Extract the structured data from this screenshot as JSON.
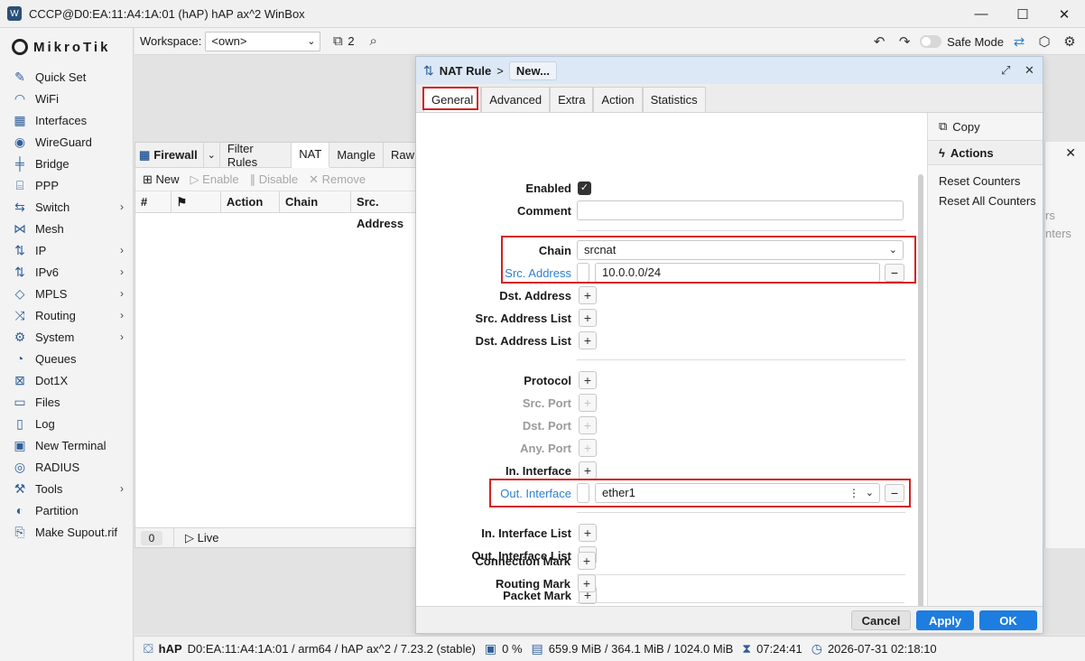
{
  "window": {
    "title": "CCCP@D0:EA:11:A4:1A:01 (hAP) hAP ax^2 WinBox",
    "controls": [
      "—",
      "☐",
      "✕"
    ]
  },
  "sidebar": {
    "logo": "MikroTik",
    "items": [
      {
        "label": "Quick Set",
        "icon": "wand-icon",
        "arrow": false
      },
      {
        "label": "WiFi",
        "icon": "wifi-icon",
        "arrow": false
      },
      {
        "label": "Interfaces",
        "icon": "interfaces-icon",
        "arrow": false
      },
      {
        "label": "WireGuard",
        "icon": "wireguard-icon",
        "arrow": false
      },
      {
        "label": "Bridge",
        "icon": "bridge-icon",
        "arrow": false
      },
      {
        "label": "PPP",
        "icon": "ppp-icon",
        "arrow": false
      },
      {
        "label": "Switch",
        "icon": "switch-icon",
        "arrow": true
      },
      {
        "label": "Mesh",
        "icon": "mesh-icon",
        "arrow": false
      },
      {
        "label": "IP",
        "icon": "ip-icon",
        "arrow": true
      },
      {
        "label": "IPv6",
        "icon": "ipv6-icon",
        "arrow": true
      },
      {
        "label": "MPLS",
        "icon": "mpls-icon",
        "arrow": true
      },
      {
        "label": "Routing",
        "icon": "routing-icon",
        "arrow": true
      },
      {
        "label": "System",
        "icon": "gear-icon",
        "arrow": true
      },
      {
        "label": "Queues",
        "icon": "queues-icon",
        "arrow": false
      },
      {
        "label": "Dot1X",
        "icon": "dot1x-icon",
        "arrow": false
      },
      {
        "label": "Files",
        "icon": "files-icon",
        "arrow": false
      },
      {
        "label": "Log",
        "icon": "log-icon",
        "arrow": false
      },
      {
        "label": "New Terminal",
        "icon": "terminal-icon",
        "arrow": false
      },
      {
        "label": "RADIUS",
        "icon": "radius-icon",
        "arrow": false
      },
      {
        "label": "Tools",
        "icon": "tools-icon",
        "arrow": true
      },
      {
        "label": "Partition",
        "icon": "partition-icon",
        "arrow": false
      },
      {
        "label": "Make Supout.rif",
        "icon": "supout-icon",
        "arrow": false
      }
    ]
  },
  "toolbar": {
    "workspace_label": "Workspace:",
    "workspace_value": "<own>",
    "windows_count": "2",
    "safe_mode_label": "Safe Mode"
  },
  "firewall": {
    "title": "Firewall",
    "tabs": [
      "Filter Rules",
      "NAT",
      "Mangle",
      "Raw"
    ],
    "active_tab": "NAT",
    "actions": {
      "new": "New",
      "enable": "Enable",
      "disable": "Disable",
      "remove": "Remove"
    },
    "columns": [
      "#",
      "Action",
      "Chain",
      "Src. Address"
    ],
    "status_count": "0",
    "live_label": "Live"
  },
  "nat_dialog": {
    "title": "NAT Rule",
    "separator": ">",
    "badge": "New...",
    "tabs": [
      "General",
      "Advanced",
      "Extra",
      "Action",
      "Statistics"
    ],
    "active_tab": "General",
    "fields": {
      "enabled_label": "Enabled",
      "comment_label": "Comment",
      "comment_value": "",
      "chain_label": "Chain",
      "chain_value": "srcnat",
      "src_address_label": "Src. Address",
      "src_address_value": "10.0.0.0/24",
      "dst_address_label": "Dst. Address",
      "src_address_list_label": "Src. Address List",
      "dst_address_list_label": "Dst. Address List",
      "protocol_label": "Protocol",
      "src_port_label": "Src. Port",
      "dst_port_label": "Dst. Port",
      "any_port_label": "Any. Port",
      "in_interface_label": "In. Interface",
      "out_interface_label": "Out. Interface",
      "out_interface_value": "ether1",
      "in_interface_list_label": "In. Interface List",
      "out_interface_list_label": "Out. Interface List",
      "packet_mark_label": "Packet Mark",
      "connection_mark_label": "Connection Mark",
      "routing_mark_label": "Routing Mark"
    },
    "side_actions": {
      "copy": "Copy",
      "header": "Actions",
      "reset_counters": "Reset Counters",
      "reset_all_counters": "Reset All Counters"
    },
    "buttons": {
      "cancel": "Cancel",
      "apply": "Apply",
      "ok": "OK"
    }
  },
  "background_panel": {
    "ghost_text_1": "rs",
    "ghost_text_2": "nters"
  },
  "statusbar": {
    "device": "hAP",
    "device_info": "D0:EA:11:A4:1A:01 / arm64 / hAP ax^2 / 7.23.2 (stable)",
    "cpu": "0 %",
    "memory": "659.9 MiB / 364.1 MiB / 1024.0 MiB",
    "uptime": "07:24:41",
    "datetime": "2026-07-31 02:18:10"
  },
  "colors": {
    "accent": "#1d7de0",
    "highlight": "#d42020",
    "link_label": "#2d7fd1"
  }
}
